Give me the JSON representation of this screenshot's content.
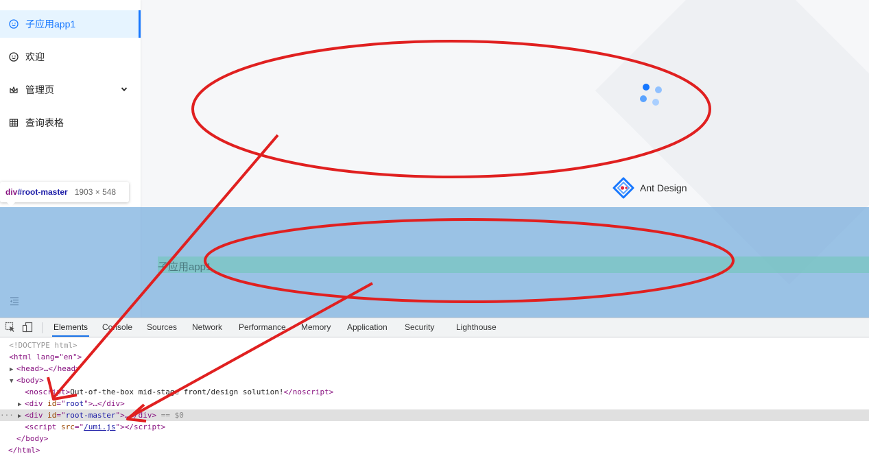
{
  "sidebar": {
    "items": [
      {
        "label": "子应用app1",
        "icon": "smile-icon",
        "active": true
      },
      {
        "label": "欢迎",
        "icon": "smile-icon",
        "active": false
      },
      {
        "label": "管理页",
        "icon": "crown-icon",
        "active": false,
        "has_submenu": true
      },
      {
        "label": "查询表格",
        "icon": "table-icon",
        "active": false
      }
    ]
  },
  "inspect_tooltip": {
    "tag": "div",
    "id": "#root-master",
    "size": "1903 × 548"
  },
  "logo": {
    "text": "Ant Design"
  },
  "overlay": {
    "content_text": "子应用app1"
  },
  "devtools": {
    "tabs": [
      "Elements",
      "Console",
      "Sources",
      "Network",
      "Performance",
      "Memory",
      "Application",
      "Security",
      "Lighthouse"
    ],
    "active_tab": "Elements",
    "dom": {
      "doctype": "<!DOCTYPE html>",
      "html_open": "<html lang=\"en\">",
      "head": "<head>…</head>",
      "body_open": "<body>",
      "noscript_text": "Out-of-the-box mid-stage front/design solution!",
      "div_root": "root",
      "div_root_master": "root-master",
      "selected_marker": "== $0",
      "script_src": "/umi.js",
      "body_close": "</body>",
      "html_close": "</html>"
    }
  },
  "colors": {
    "primary": "#1677ff",
    "active_bg": "#e6f4ff",
    "overlay": "#6fa8dc",
    "annotation": "#e02020"
  }
}
